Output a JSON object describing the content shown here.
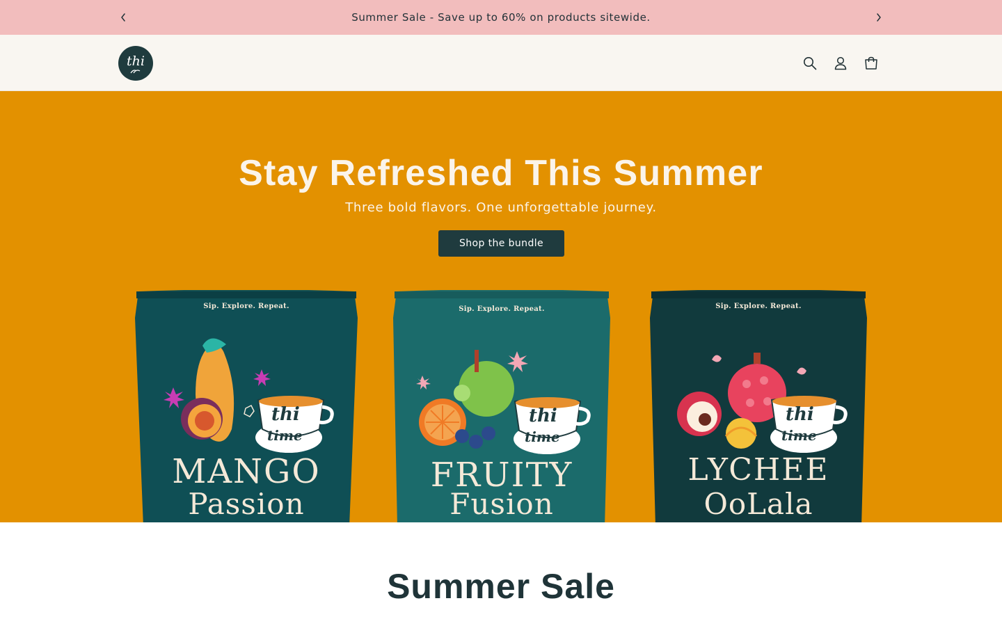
{
  "announcement": {
    "message": "Summer Sale - Save up to 60% on products sitewide.",
    "prev_icon": "chevron-left-icon",
    "next_icon": "chevron-right-icon"
  },
  "header": {
    "logo_text": "thi",
    "icons": [
      "search-icon",
      "account-icon",
      "cart-icon"
    ]
  },
  "hero": {
    "title": "Stay Refreshed This Summer",
    "subtitle": "Three bold flavors. One unforgettable journey.",
    "cta_label": "Shop the bundle",
    "background_color": "#e39100",
    "products": [
      {
        "tagline": "Sip. Explore. Repeat.",
        "brand_top": "thi",
        "brand_bottom": "time",
        "name_line1": "MANGO",
        "name_line2": "Passion",
        "color": "#0f4f55"
      },
      {
        "tagline": "Sip. Explore. Repeat.",
        "brand_top": "thi",
        "brand_bottom": "time",
        "name_line1": "FRUITY",
        "name_line2": "Fusion",
        "color": "#1b6b6b"
      },
      {
        "tagline": "Sip. Explore. Repeat.",
        "brand_top": "thi",
        "brand_bottom": "time",
        "name_line1": "LYCHEE",
        "name_line2": "OoLala",
        "color": "#113a3d"
      }
    ]
  },
  "section": {
    "title": "Summer Sale"
  },
  "colors": {
    "announcement_bg": "#f2bdbd",
    "header_bg": "#f9f6f1",
    "brand_dark": "#1f3b3e"
  }
}
